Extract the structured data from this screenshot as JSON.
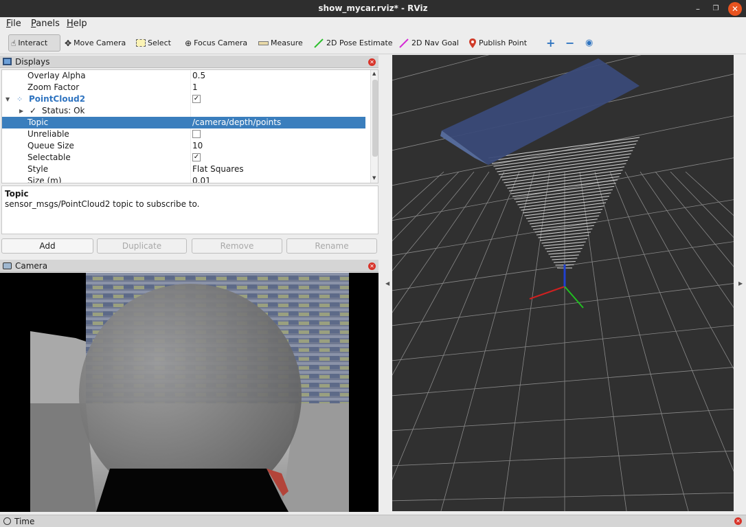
{
  "window": {
    "title": "show_mycar.rviz* - RViz"
  },
  "menu": [
    {
      "accel": "F",
      "rest": "ile"
    },
    {
      "accel": "P",
      "rest": "anels"
    },
    {
      "accel": "H",
      "rest": "elp"
    }
  ],
  "toolbar": {
    "interact": "Interact",
    "move_camera": "Move Camera",
    "select": "Select",
    "focus_camera": "Focus Camera",
    "measure": "Measure",
    "pose_estimate": "2D Pose Estimate",
    "nav_goal": "2D Nav Goal",
    "publish_point": "Publish Point",
    "pose_color": "#2dbf2d",
    "nav_color": "#d42bd4",
    "point_color": "#d03c2a"
  },
  "displays": {
    "title": "Displays",
    "rows": {
      "overlay_alpha": {
        "key": "Overlay Alpha",
        "value": "0.5"
      },
      "zoom_factor": {
        "key": "Zoom Factor",
        "value": "1"
      },
      "pointcloud": {
        "key": "PointCloud2",
        "checked": true
      },
      "status": {
        "key": "Status: Ok"
      },
      "topic": {
        "key": "Topic",
        "value": "/camera/depth/points"
      },
      "unreliable": {
        "key": "Unreliable",
        "checked": false
      },
      "queue_size": {
        "key": "Queue Size",
        "value": "10"
      },
      "selectable": {
        "key": "Selectable",
        "checked": true
      },
      "style": {
        "key": "Style",
        "value": "Flat Squares"
      },
      "size": {
        "key": "Size (m)",
        "value": "0.01"
      }
    },
    "description": {
      "title": "Topic",
      "text": "sensor_msgs/PointCloud2 topic to subscribe to."
    },
    "buttons": {
      "add": "Add",
      "duplicate": "Duplicate",
      "remove": "Remove",
      "rename": "Rename"
    },
    "selected_color": "#3a7ebd",
    "pointcloud_color": "#2f74c0"
  },
  "camera": {
    "title": "Camera"
  },
  "time": {
    "title": "Time"
  }
}
